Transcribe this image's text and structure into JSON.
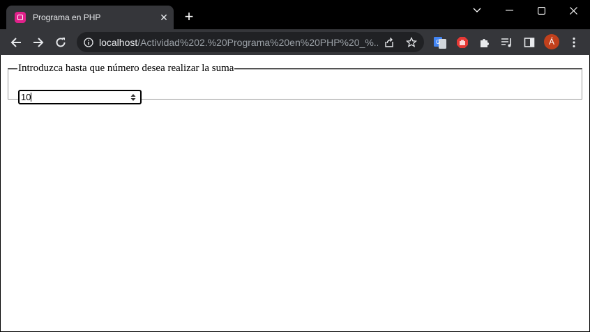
{
  "browser": {
    "tab_title": "Programa en PHP",
    "url_host": "localhost",
    "url_path": "/Actividad%202.%20Programa%20en%20PHP%20_%...",
    "profile_initial": "Á"
  },
  "form": {
    "legend": "Introduzca hasta que número desea realizar la suma",
    "number_value": "10"
  }
}
